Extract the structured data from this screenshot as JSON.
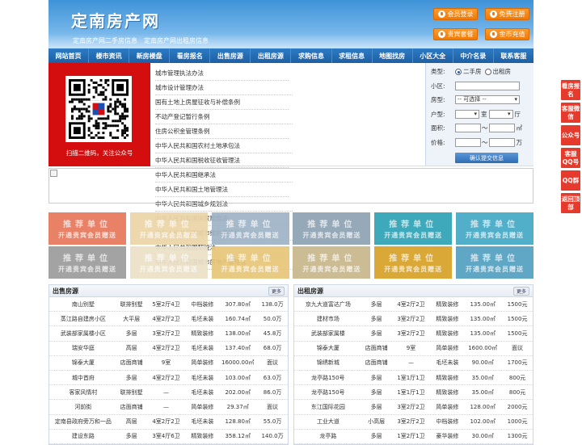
{
  "header": {
    "title": "定南房产网",
    "subtitle": "定南房产网二手房信息　定南房产网出租房信息",
    "buttons": [
      "会员登录",
      "免费注册",
      "贵宾套餐",
      "金币充值"
    ]
  },
  "nav": [
    "网站首页",
    "楼市资讯",
    "新房楼盘",
    "看房报名",
    "出售房源",
    "出租房源",
    "求购信息",
    "求租信息",
    "地图找房",
    "小区大全",
    "中介名录",
    "联系客服"
  ],
  "qr": {
    "caption": "扫描二维码，关注公众号"
  },
  "links": [
    "城市管理执法办法",
    "城市设计管理办法",
    "国有土地上房屋征收与补偿条例",
    "不动产登记暂行条例",
    "住房公积金管理条例",
    "中华人民共和国农村土地承包法",
    "中华人民共和国税收征收管理法",
    "中华人民共和国继承法",
    "中华人民共和国土地管理法",
    "中华人民共和国城乡规划法",
    "中华人民共和国国家赔偿法",
    "中华人民共和国城市维护建设税法",
    "中华人民共和国契税法",
    "中华人民共和国城市房地产管理法"
  ],
  "search": {
    "type_label": "类型:",
    "opt1": "二手房",
    "opt2": "出租房",
    "community_label": "小区:",
    "room_label": "房型:",
    "room_placeholder": "-- 可选择 --",
    "layout_label": "户型:",
    "shi": "室",
    "ting": "厅",
    "area_label": "面积:",
    "area_unit": "㎡",
    "price_label": "价格:",
    "price_unit": "万",
    "submit": "确认提交信息",
    "dash": "～"
  },
  "promo": {
    "t1": "推荐单位",
    "t2": "开通贵宾会员赠送",
    "colors": [
      "#e8785c",
      "#ecd6a8",
      "#9fb4c6",
      "#8fa3b4",
      "#2fa3b6",
      "#45a9c7",
      "#9d9d9d",
      "#ece1c8",
      "#e8c679",
      "#c9b78c",
      "#d7a228",
      "#54a1c2"
    ]
  },
  "sale": {
    "title": "出售房源",
    "more": "更多",
    "rows": [
      [
        "南山别墅",
        "联排别墅",
        "5室2厅4卫",
        "中档装修",
        "307.80㎡",
        "138.0万"
      ],
      [
        "蒸江路自建房小区",
        "大平层",
        "4室2厅2卫",
        "毛坯未装",
        "160.74㎡",
        "50.0万"
      ],
      [
        "武装部家属楼小区",
        "多层",
        "3室2厅2卫",
        "精致装修",
        "138.00㎡",
        "45.8万"
      ],
      [
        "瑞安华庭",
        "高层",
        "4室2厅2卫",
        "毛坯未装",
        "137.40㎡",
        "68.0万"
      ],
      [
        "锦泰大厦",
        "店面商铺",
        "9室",
        "简单装修",
        "16000.00㎡",
        "面议"
      ],
      [
        "城中首府",
        "多层",
        "4室2厅2卫",
        "毛坯未装",
        "103.00㎡",
        "63.0万"
      ],
      [
        "客家风情村",
        "联排别墅",
        "—",
        "毛坯未装",
        "202.00㎡",
        "86.0万"
      ],
      [
        "河前街",
        "店面商铺",
        "—",
        "简单装修",
        "29.37㎡",
        "面议"
      ],
      [
        "定南县政府旁万和一品",
        "高层",
        "4室2厅2卫",
        "毛坯未装",
        "128.80㎡",
        "55.0万"
      ],
      [
        "建设东路",
        "多层",
        "3室4厅6卫",
        "精致装修",
        "358.12㎡",
        "140.0万"
      ]
    ]
  },
  "rent": {
    "title": "出租房源",
    "more": "更多",
    "rows": [
      [
        "京九大道富达广场",
        "多层",
        "4室2厅2卫",
        "精致装修",
        "135.00㎡",
        "1500元"
      ],
      [
        "建材市场",
        "多层",
        "3室2厅2卫",
        "精致装修",
        "135.00㎡",
        "1500元"
      ],
      [
        "武装部家属楼",
        "多层",
        "3室2厅2卫",
        "精致装修",
        "135.00㎡",
        "1500元"
      ],
      [
        "锦泰大厦",
        "店面商铺",
        "9室",
        "简单装修",
        "1600.00㎡",
        "面议"
      ],
      [
        "锦绣新城",
        "店面商铺",
        "—",
        "毛坯未装",
        "90.00㎡",
        "1700元"
      ],
      [
        "龙亭路150号",
        "多层",
        "1室1厅1卫",
        "精致装修",
        "35.00㎡",
        "800元"
      ],
      [
        "龙亭路150号",
        "多层",
        "1室1厅1卫",
        "精致装修",
        "35.00㎡",
        "800元"
      ],
      [
        "东江国际花园",
        "多层",
        "3室2厅2卫",
        "简单装修",
        "128.00㎡",
        "2000元"
      ],
      [
        "工业大道",
        "小高层",
        "3室2厅2卫",
        "中档装修",
        "102.00㎡",
        "1000元"
      ],
      [
        "龙亭路",
        "多层",
        "1室2厅1卫",
        "豪华装修",
        "30.00㎡",
        "1300元"
      ]
    ]
  },
  "side": [
    "看房报名",
    "客服微信",
    "公众号",
    "客服QQ号",
    "QQ群",
    "返回顶部"
  ]
}
